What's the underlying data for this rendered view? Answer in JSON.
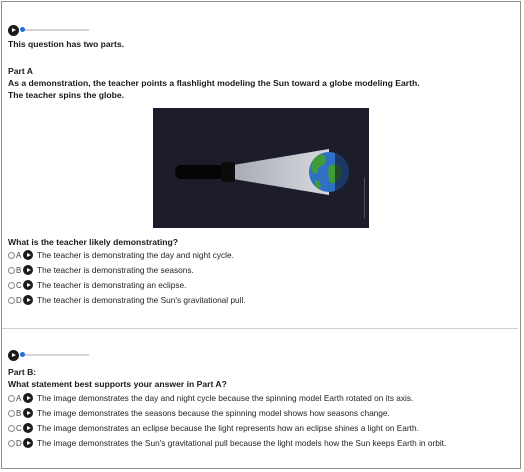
{
  "part_a": {
    "intro": "This question has two parts.",
    "heading": "Part A",
    "prompt_line1": "As a demonstration, the teacher points a flashlight modeling the Sun toward a globe modeling Earth.",
    "prompt_line2": "The teacher spins the globe.",
    "question": "What is the teacher likely demonstrating?",
    "options": [
      {
        "letter": "A",
        "text": "The teacher is demonstrating the day and night cycle."
      },
      {
        "letter": "B",
        "text": "The teacher is demonstrating the seasons."
      },
      {
        "letter": "C",
        "text": "The teacher is demonstrating an eclipse."
      },
      {
        "letter": "D",
        "text": "The teacher is demonstrating the Sun's gravitational pull."
      }
    ]
  },
  "part_b": {
    "heading": "Part B:",
    "question": "What statement best supports your answer in Part A?",
    "options": [
      {
        "letter": "A",
        "text": "The image demonstrates the day and night cycle because the spinning model Earth rotated on its axis."
      },
      {
        "letter": "B",
        "text": "The image demonstrates the seasons because the spinning model shows how seasons change."
      },
      {
        "letter": "C",
        "text": "The image demonstrates an eclipse because the light represents how an eclipse shines a light on Earth."
      },
      {
        "letter": "D",
        "text": "The image demonstrates the Sun's gravitational pull because the light models how the Sun keeps Earth in orbit."
      }
    ]
  },
  "icons": {
    "audio_play": "play-icon",
    "option_play": "play-icon",
    "radio": "radio-button"
  },
  "colors": {
    "audio_progress": "#1f6fd6",
    "figure_background": "#1d1c2b",
    "light_beam": "#bfc2c9",
    "earth_ocean": "#2f6fc4",
    "earth_land": "#3f9a3a"
  }
}
